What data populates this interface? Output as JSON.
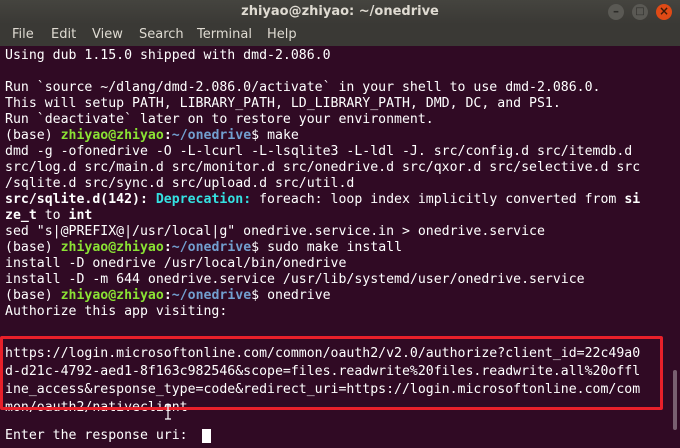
{
  "window": {
    "title": "zhiyao@zhiyao: ~/onedrive"
  },
  "menu": [
    "File",
    "Edit",
    "View",
    "Search",
    "Terminal",
    "Help"
  ],
  "prompt": {
    "env": "(base)",
    "user_host": "zhiyao@zhiyao",
    "sep": ":",
    "path": "~/onedrive",
    "dollar": "$"
  },
  "terminal": {
    "l1": "Using dub 1.15.0 shipped with dmd-2.086.0",
    "l3": "Run `source ~/dlang/dmd-2.086.0/activate` in your shell to use dmd-2.086.0.",
    "l4": "This will setup PATH, LIBRARY_PATH, LD_LIBRARY_PATH, DMD, DC, and PS1.",
    "l5": "Run `deactivate` later on to restore your environment.",
    "cmd_make": " make",
    "l7": "dmd -g -ofonedrive -O -L-lcurl -L-lsqlite3 -L-ldl -J. src/config.d src/itemdb.d",
    "l8": "src/log.d src/main.d src/monitor.d src/onedrive.d src/qxor.d src/selective.d src",
    "l9": "/sqlite.d src/sync.d src/upload.d src/util.d",
    "l10_file": "src/sqlite.d(142):",
    "l10_dep": " Deprecation:",
    "l10_rest": " foreach: loop index implicitly converted from ",
    "l10_type": "si",
    "l11_type": "ze_t",
    "l11_to": " to ",
    "l11_int": "int",
    "l12": "sed \"s|@PREFIX@|/usr/local|g\" onedrive.service.in > onedrive.service",
    "cmd_install": " sudo make install",
    "l14": "install -D onedrive /usr/local/bin/onedrive",
    "l15": "install -D -m 644 onedrive.service /usr/lib/systemd/user/onedrive.service",
    "cmd_onedrive": " onedrive",
    "l17": "Authorize this app visiting:",
    "url1": "https://login.microsoftonline.com/common/oauth2/v2.0/authorize?client_id=22c49a0",
    "url2": "d-d21c-4792-aed1-8f163c982546&scope=files.readwrite%20files.readwrite.all%20offl",
    "url3": "ine_access&response_type=code&redirect_uri=https://login.microsoftonline.com/com",
    "url4": "mon/oauth2/nativeclient",
    "l23": "Enter the response uri: "
  },
  "colors": {
    "background": "#300a24",
    "prompt_user": "#8ae234",
    "prompt_path": "#729fcf",
    "deprecation": "#34e2e2",
    "highlight": "#e8202a"
  },
  "icons": {
    "minimize": "minimize-icon",
    "maximize": "maximize-icon",
    "close": "close-icon",
    "mouse": "text-cursor-icon"
  }
}
